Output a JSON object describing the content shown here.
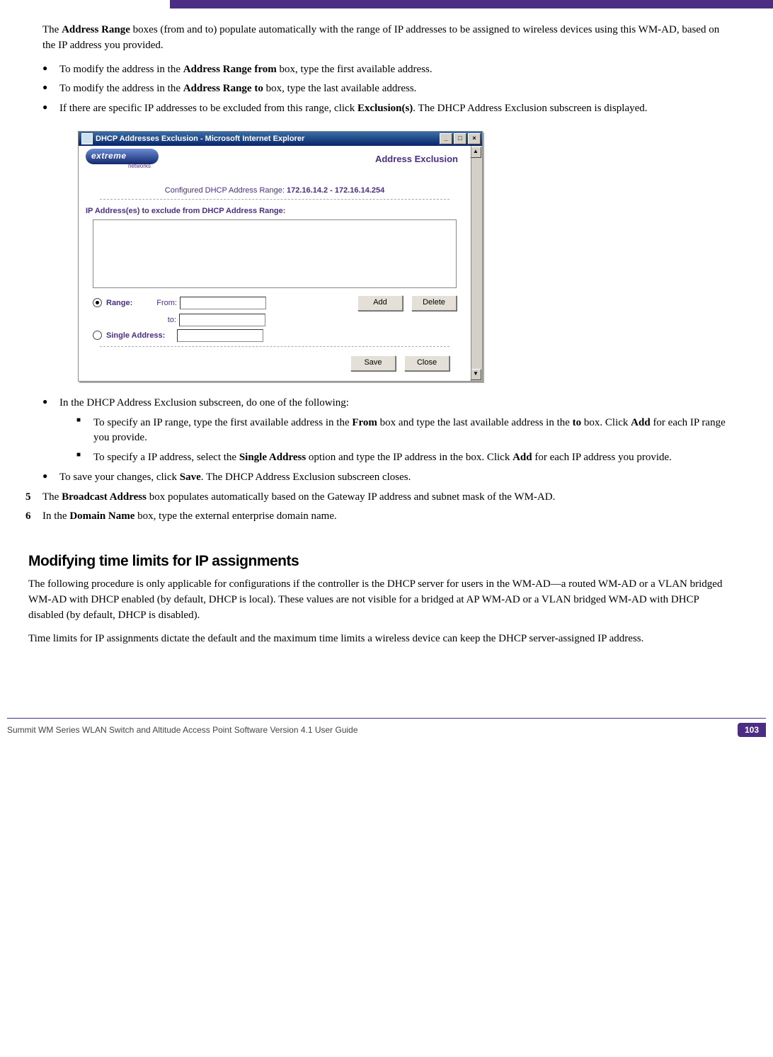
{
  "intro_para": "The Address Range boxes (from and to) populate automatically with the range of IP addresses to be assigned to wireless devices using this WM-AD, based on the IP address you provided.",
  "bullets_top": {
    "b1_pre": "To modify the address in the ",
    "b1_bold": "Address Range from",
    "b1_post": " box, type the first available address.",
    "b2_pre": "To modify the address in the ",
    "b2_bold": "Address Range to",
    "b2_post": " box, type the last available address.",
    "b3_pre": "If there are specific IP addresses to be excluded from this range, click ",
    "b3_bold": "Exclusion(s)",
    "b3_post": ". The DHCP Address Exclusion subscreen is displayed."
  },
  "dialog": {
    "titlebar": "DHCP Addresses Exclusion - Microsoft Internet Explorer",
    "brand": "extreme",
    "brand_sub": "networks",
    "header": "Address Exclusion",
    "config_label": "Configured DHCP Address Range: ",
    "config_val": "172.16.14.2 - 172.16.14.254",
    "list_label": "IP Address(es) to exclude from DHCP Address Range:",
    "range_label": "Range:",
    "from_label": "From:",
    "to_label": "to:",
    "single_label": "Single Address:",
    "btn_add": "Add",
    "btn_delete": "Delete",
    "btn_save": "Save",
    "btn_close": "Close"
  },
  "bullets_mid": {
    "b1": "In the DHCP Address Exclusion subscreen, do one of the following:",
    "s1_pre": "To specify an IP range, type the first available address in the ",
    "s1_b1": "From",
    "s1_mid": " box and type the last available address in the ",
    "s1_b2": "to",
    "s1_mid2": " box. Click ",
    "s1_b3": "Add",
    "s1_post": " for each IP range you provide.",
    "s2_pre": "To specify a IP address, select the ",
    "s2_b1": "Single Address",
    "s2_mid": " option and type the IP address in the box. Click ",
    "s2_b2": "Add",
    "s2_post": " for each IP address you provide.",
    "b2_pre": "To save your changes, click ",
    "b2_bold": "Save",
    "b2_post": ". The DHCP Address Exclusion subscreen closes."
  },
  "num5_pre": "The ",
  "num5_bold": "Broadcast Address",
  "num5_post": " box populates automatically based on the Gateway IP address and subnet mask of the WM-AD.",
  "num6_pre": "In the ",
  "num6_bold": "Domain Name",
  "num6_post": " box, type the external enterprise domain name.",
  "heading": "Modifying time limits for IP assignments",
  "sec_p1": "The following procedure is only applicable for configurations if the controller is the DHCP server for users in the WM-AD—a routed WM-AD or a VLAN bridged WM-AD with DHCP enabled (by default, DHCP is local). These values are not visible for a bridged at AP WM-AD or a VLAN bridged WM-AD with DHCP disabled (by default, DHCP is disabled).",
  "sec_p2": "Time limits for IP assignments dictate the default and the maximum time limits a wireless device can keep the DHCP server-assigned IP address.",
  "footer": "Summit WM Series WLAN Switch and Altitude Access Point Software Version 4.1 User Guide",
  "page_number": "103"
}
